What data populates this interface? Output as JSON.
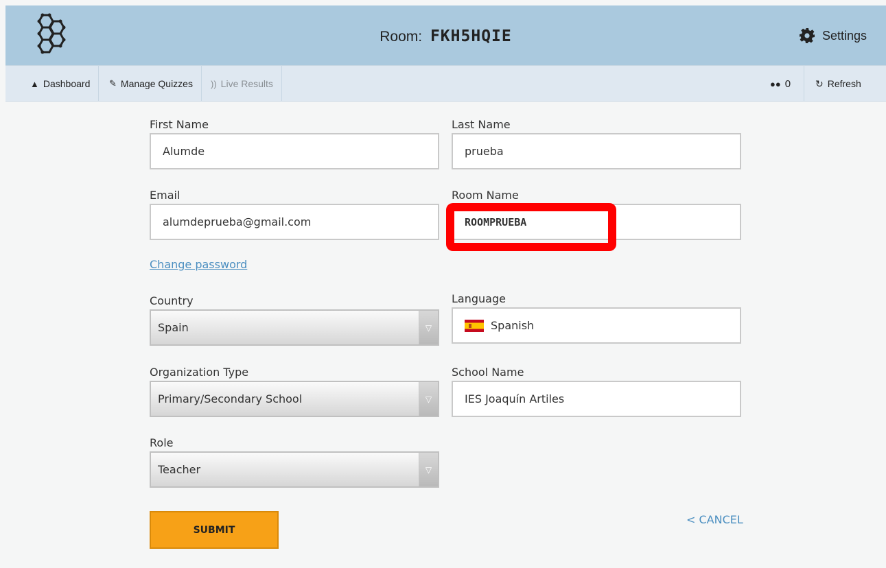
{
  "header": {
    "room_label": "Room:",
    "room_code": "FKH5HQIE",
    "settings_label": "Settings",
    "logo_icon": "hexagon-logo-icon",
    "settings_icon": "gear-icon"
  },
  "nav": {
    "items": [
      {
        "label": "Dashboard",
        "icon": "home-icon"
      },
      {
        "label": "Manage Quizzes",
        "icon": "wrench-icon"
      },
      {
        "label": "Live Results",
        "icon": "broadcast-icon"
      }
    ],
    "student_count": "0",
    "refresh_label": "Refresh"
  },
  "form": {
    "first_name": {
      "label": "First Name",
      "value": "Alumde"
    },
    "last_name": {
      "label": "Last Name",
      "value": "prueba"
    },
    "email": {
      "label": "Email",
      "value": "alumdeprueba@gmail.com"
    },
    "room_name": {
      "label": "Room Name",
      "value": "ROOMPRUEBA"
    },
    "change_password": "Change password",
    "country": {
      "label": "Country",
      "value": "Spain"
    },
    "language": {
      "label": "Language",
      "value": "Spanish"
    },
    "organization_type": {
      "label": "Organization Type",
      "value": "Primary/Secondary School"
    },
    "school_name": {
      "label": "School Name",
      "value": "IES Joaquín Artiles"
    },
    "role": {
      "label": "Role",
      "value": "Teacher"
    },
    "submit_label": "SUBMIT",
    "cancel_label": "< CANCEL"
  },
  "colors": {
    "header_bg": "#aac9de",
    "nav_bg": "#dfe8f1",
    "submit_bg": "#f7a117",
    "link": "#4a8ec0",
    "highlight": "#ff0000"
  }
}
